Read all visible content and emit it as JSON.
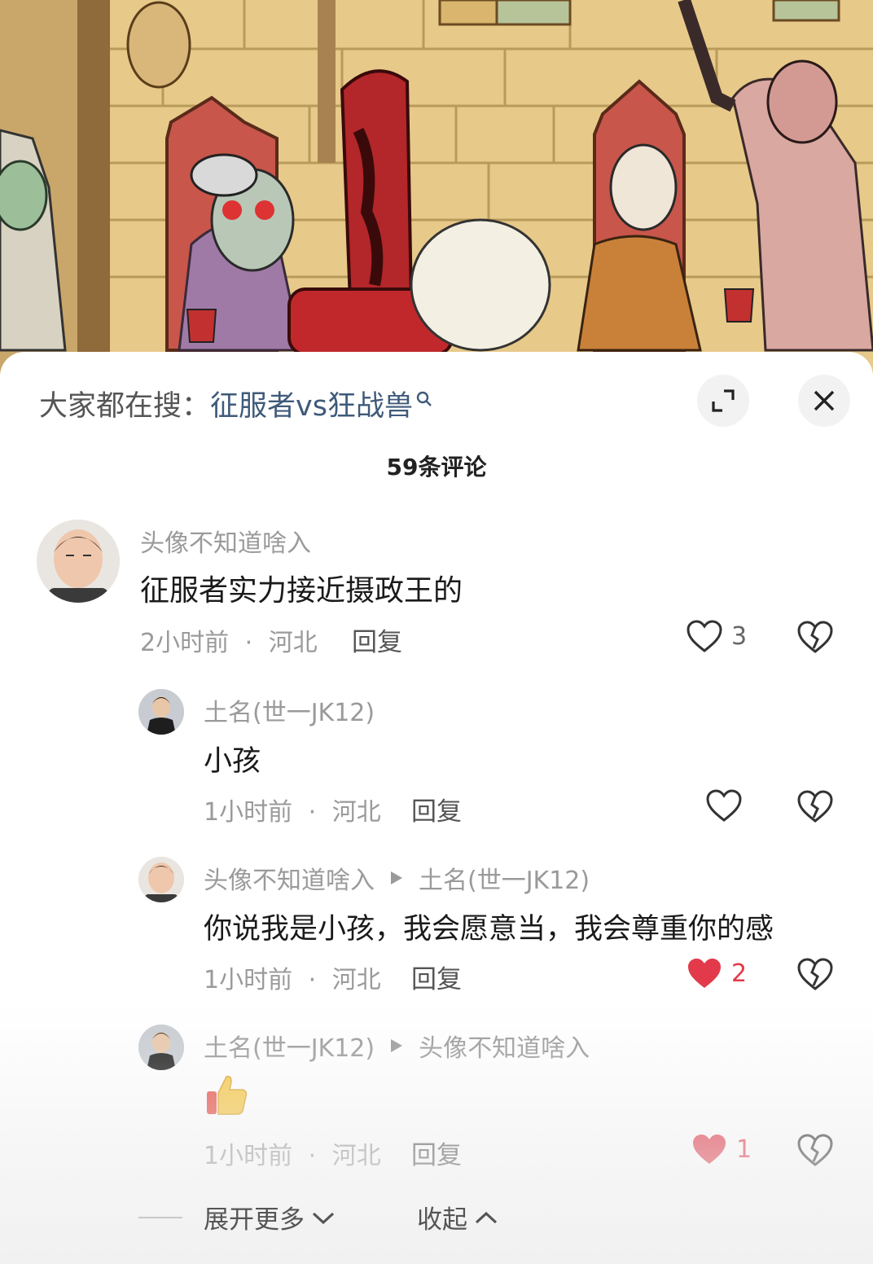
{
  "search": {
    "prefix": "大家都在搜：",
    "query": "征服者vs狂战兽"
  },
  "comments_title": "59条评论",
  "comments": [
    {
      "user": "头像不知道啥入",
      "text": "征服者实力接近摄政王的",
      "time": "2小时前",
      "location": "河北",
      "reply_label": "回复",
      "likes": "3",
      "liked": false
    },
    {
      "user": "土名(世一JK12)",
      "text": "小孩",
      "time": "1小时前",
      "location": "河北",
      "reply_label": "回复",
      "likes": "",
      "liked": false
    },
    {
      "user": "头像不知道啥入",
      "reply_to": "土名(世一JK12)",
      "text": "你说我是小孩，我会愿意当，我会尊重你的感",
      "time": "1小时前",
      "location": "河北",
      "reply_label": "回复",
      "likes": "2",
      "liked": true
    },
    {
      "user": "土名(世一JK12)",
      "reply_to": "头像不知道啥入",
      "emoji": "thumbs-up-emoji",
      "time": "1小时前",
      "location": "河北",
      "reply_label": "回复",
      "likes": "1",
      "liked": true
    }
  ],
  "actions": {
    "expand_more": "展开更多",
    "collapse": "收起"
  },
  "colors": {
    "query_blue": "#3f5a7a",
    "like_red": "#e23a4a",
    "meta_gray": "#9a9a9a"
  }
}
